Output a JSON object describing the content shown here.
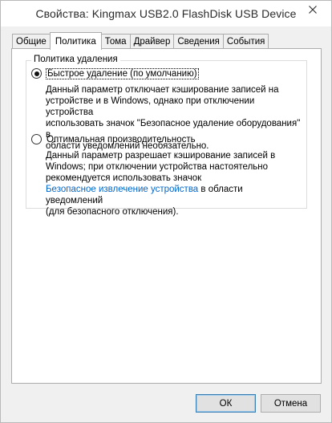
{
  "window": {
    "title": "Свойства: Kingmax USB2.0 FlashDisk USB Device"
  },
  "tabs": [
    {
      "label": "Общие"
    },
    {
      "label": "Политика"
    },
    {
      "label": "Тома"
    },
    {
      "label": "Драйвер"
    },
    {
      "label": "Сведения"
    },
    {
      "label": "События"
    }
  ],
  "policy": {
    "group_title": "Политика удаления",
    "quick": {
      "label": "Быстрое удаление (по умолчанию)",
      "selected": true,
      "desc_lines": [
        "Данный параметр отключает кэширование записей на",
        "устройстве и в Windows, однако при отключении устройства",
        "использовать значок \"Безопасное удаление оборудования\" в",
        "области уведомлений необязательно."
      ]
    },
    "optimal": {
      "label": "Оптимальная производительность",
      "selected": false,
      "desc_lines": [
        "Данный параметр разрешает кэширование записей в",
        "Windows; при отключении устройства настоятельно",
        "рекомендуется использовать значок"
      ],
      "link_text": "Безопасное извлечение устройства",
      "after_link": " в области уведомлений",
      "last_line": "(для безопасного отключения)."
    }
  },
  "buttons": {
    "ok": "ОК",
    "cancel": "Отмена"
  },
  "icons": {
    "close": "close-icon"
  }
}
